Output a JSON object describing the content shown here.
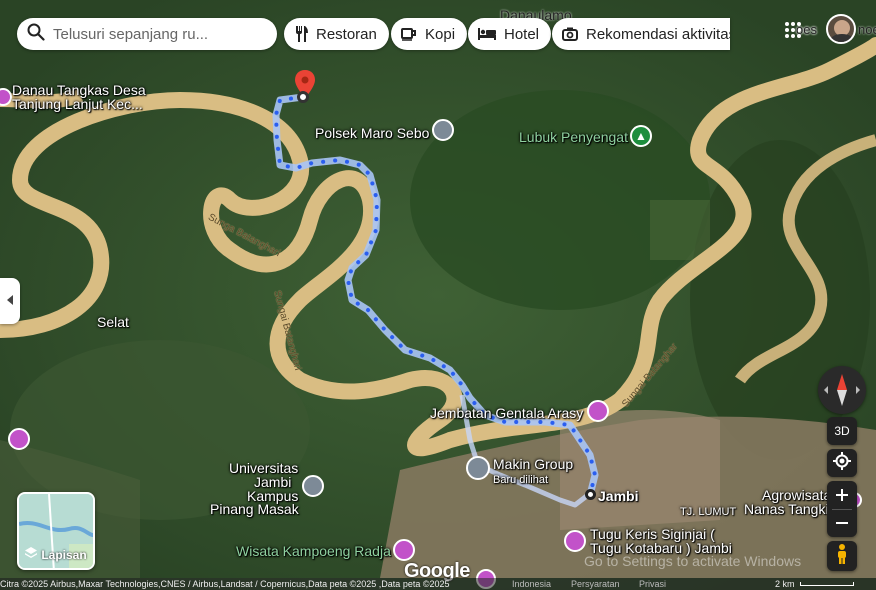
{
  "search": {
    "placeholder": "Telusuri sepanjang ru..."
  },
  "chips": [
    {
      "label": "Restoran",
      "icon": "fork-knife-icon"
    },
    {
      "label": "Kopi",
      "icon": "coffee-icon"
    },
    {
      "label": "Hotel",
      "icon": "bed-icon"
    },
    {
      "label": "Rekomendasi aktivitas",
      "icon": "camera-icon"
    }
  ],
  "account": {
    "name_fragment": "oes",
    "name_tail": "noe"
  },
  "places": {
    "danaulamo": "Danaulamo",
    "danau_tangkas_1": "Danau Tangkas Desa",
    "danau_tangkas_2": "Tanjung Lanjut Kec...",
    "polsek": "Polsek Maro Sebo",
    "lubuk": "Lubuk Penyengat",
    "selat": "Selat",
    "jembatan": "Jembatan Gentala Arasy",
    "makin": "Makin Group",
    "makin_sub": "Baru dilihat",
    "jambi": "Jambi",
    "univ_1": "Universitas",
    "univ_2": "Jambi",
    "univ_3": "Kampus",
    "univ_4": "Pinang Masak",
    "tj_lumut": "TJ. LUMUT",
    "agro_1": "Agrowisata",
    "agro_2": "Nanas Tangkit",
    "tugu_1": "Tugu Keris Siginjai (",
    "tugu_2": "Tugu Kotabaru ) Jambi",
    "wisata": "Wisata Kampoeng Radja"
  },
  "rivers": {
    "r1": "Sunga Batanghari",
    "r2": "Sungai Batanghari",
    "r3": "Sungai Batanghar"
  },
  "layers": {
    "label": "Lapisan"
  },
  "controls": {
    "three_d": "3D"
  },
  "branding": {
    "google": "Google",
    "watermark": "Go to Settings to activate Windows"
  },
  "footer": {
    "attribution": "Citra ©2025 Airbus,Maxar Technologies,CNES / Airbus,Landsat / Copernicus,Data peta ©2025 ,Data peta ©2025",
    "country": "Indonesia",
    "terms": "Persyaratan",
    "privacy": "Privasi",
    "scale": "2 km"
  },
  "colors": {
    "route": "#2a5ef0",
    "river": "#d9bd83",
    "pin_red": "#ea4335",
    "pin_pink": "#c252c9"
  }
}
